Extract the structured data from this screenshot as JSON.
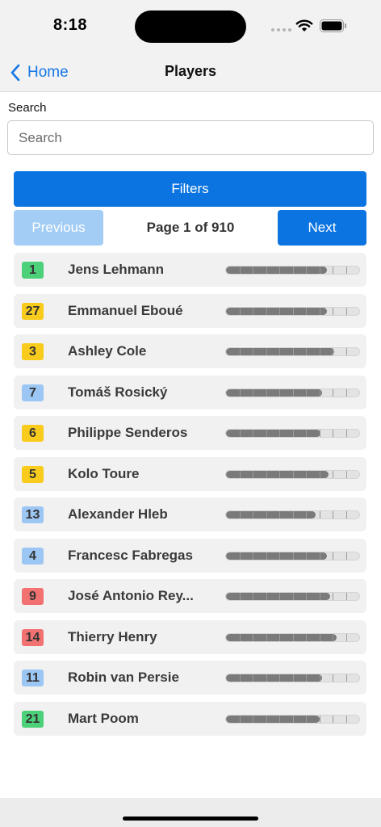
{
  "status_bar": {
    "time": "8:18"
  },
  "nav": {
    "back_label": "Home",
    "title": "Players"
  },
  "search": {
    "label": "Search",
    "placeholder": "Search",
    "value": ""
  },
  "filters": {
    "label": "Filters"
  },
  "pagination": {
    "previous_label": "Previous",
    "page_text": "Page 1 of 910",
    "next_label": "Next"
  },
  "colors": {
    "green": "#4cd07a",
    "yellow": "#f8cb1c",
    "blue": "#9cc7f4",
    "red": "#f27272"
  },
  "players": [
    {
      "number": "1",
      "name": "Jens Lehmann",
      "badge_color": "green",
      "rating": 0.76
    },
    {
      "number": "27",
      "name": "Emmanuel Eboué",
      "badge_color": "yellow",
      "rating": 0.76
    },
    {
      "number": "3",
      "name": "Ashley Cole",
      "badge_color": "yellow",
      "rating": 0.81
    },
    {
      "number": "7",
      "name": "Tomáš Rosický",
      "badge_color": "blue",
      "rating": 0.72
    },
    {
      "number": "6",
      "name": "Philippe Senderos",
      "badge_color": "yellow",
      "rating": 0.71
    },
    {
      "number": "5",
      "name": "Kolo Toure",
      "badge_color": "yellow",
      "rating": 0.77
    },
    {
      "number": "13",
      "name": "Alexander Hleb",
      "badge_color": "blue",
      "rating": 0.67
    },
    {
      "number": "4",
      "name": "Francesc Fabregas",
      "badge_color": "blue",
      "rating": 0.76
    },
    {
      "number": "9",
      "name": "José Antonio Rey...",
      "badge_color": "red",
      "rating": 0.78
    },
    {
      "number": "14",
      "name": "Thierry Henry",
      "badge_color": "red",
      "rating": 0.83
    },
    {
      "number": "11",
      "name": "Robin van Persie",
      "badge_color": "blue",
      "rating": 0.72
    },
    {
      "number": "21",
      "name": "Mart Poom",
      "badge_color": "green",
      "rating": 0.7
    }
  ]
}
